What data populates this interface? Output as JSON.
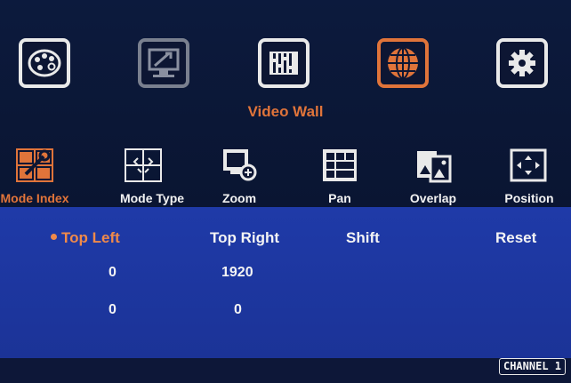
{
  "main_tabs": [
    {
      "icon": "palette-icon",
      "active": false
    },
    {
      "icon": "display-tools-icon",
      "active": false
    },
    {
      "icon": "audio-mixer-icon",
      "active": false
    },
    {
      "icon": "globe-icon",
      "active": true
    },
    {
      "icon": "gear-icon",
      "active": false
    }
  ],
  "section_title": "Video Wall",
  "sub_tabs": [
    {
      "label": "Mode Index",
      "icon": "mode-index-icon",
      "active": true
    },
    {
      "label": "Mode Type",
      "icon": "mode-type-icon",
      "active": false
    },
    {
      "label": "Zoom",
      "icon": "zoom-icon",
      "active": false
    },
    {
      "label": "Pan",
      "icon": "pan-grid-icon",
      "active": false
    },
    {
      "label": "Overlap",
      "icon": "overlap-icon",
      "active": false
    },
    {
      "label": "Position",
      "icon": "position-icon",
      "active": false
    }
  ],
  "settings": {
    "headers": [
      "Top Left",
      "Top Right",
      "Shift",
      "Reset"
    ],
    "selected_header": "Top Left",
    "rows": [
      [
        "0",
        "1920"
      ],
      [
        "0",
        "0"
      ]
    ]
  },
  "channel_badge": "CHANNEL 1",
  "colors": {
    "accent": "#e0743a",
    "panel_blue": "#1f3aa8",
    "background": "#0b1633"
  }
}
